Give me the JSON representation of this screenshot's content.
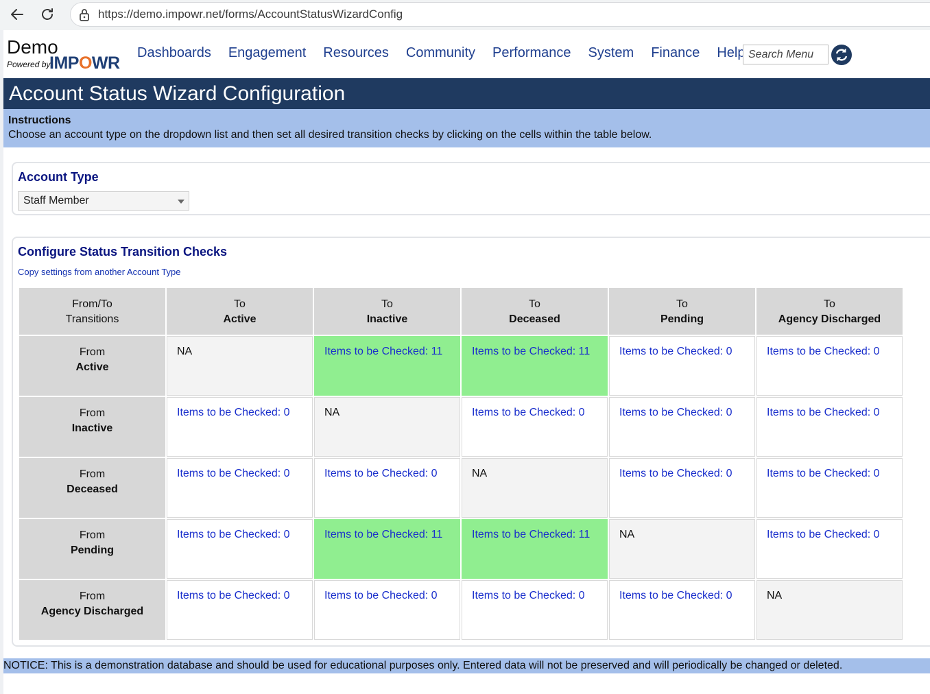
{
  "browser": {
    "url": "https://demo.impowr.net/forms/AccountStatusWizardConfig"
  },
  "logo": {
    "demo": "Demo",
    "powered": "Powered by",
    "brand_a": "IMP",
    "brand_o": "O",
    "brand_b": "WR"
  },
  "menu": [
    "Dashboards",
    "Engagement",
    "Resources",
    "Community",
    "Performance",
    "System",
    "Finance",
    "Help"
  ],
  "search": {
    "placeholder": "Search Menu"
  },
  "page_title": "Account Status Wizard Configuration",
  "instructions": {
    "heading": "Instructions",
    "text": "Choose an account type on the dropdown list and then set all desired transition checks by clicking on the cells within the table below."
  },
  "account_type": {
    "label": "Account Type",
    "selected": "Staff Member"
  },
  "config": {
    "title": "Configure Status Transition Checks",
    "copy_link": "Copy settings from another Account Type",
    "corner_line1": "From/To",
    "corner_line2": "Transitions",
    "to_prefix": "To",
    "from_prefix": "From",
    "statuses": [
      "Active",
      "Inactive",
      "Deceased",
      "Pending",
      "Agency Discharged"
    ],
    "cell_prefix": "Items to be Checked: ",
    "na": "NA",
    "matrix": [
      [
        null,
        11,
        11,
        0,
        0
      ],
      [
        0,
        null,
        0,
        0,
        0
      ],
      [
        0,
        0,
        null,
        0,
        0
      ],
      [
        0,
        11,
        11,
        null,
        0
      ],
      [
        0,
        0,
        0,
        0,
        null
      ]
    ],
    "highlight_color": "#90ee90"
  },
  "notice": "NOTICE: This is a demonstration database and should be used for educational purposes only. Entered data will not be preserved and will periodically be changed or deleted."
}
